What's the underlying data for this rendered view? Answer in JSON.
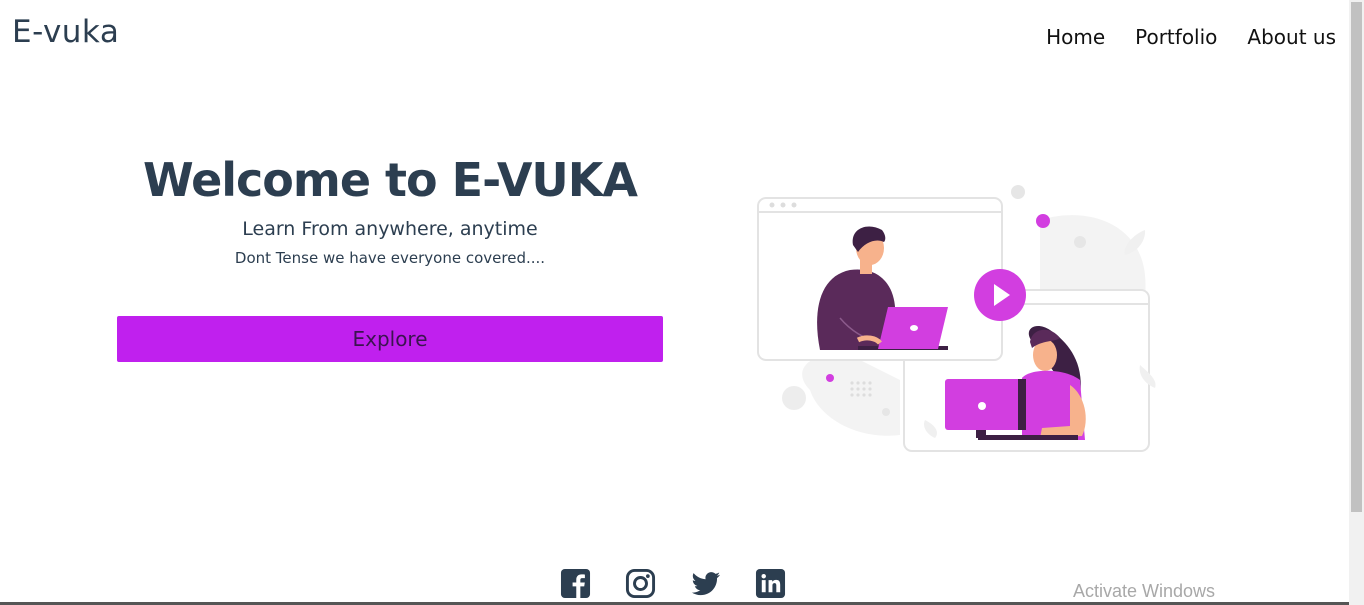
{
  "header": {
    "logo": "E-vuka",
    "nav": [
      "Home",
      "Portfolio",
      "About us"
    ]
  },
  "hero": {
    "title": "Welcome to E-VUKA",
    "subtitle": "Learn From anywhere, anytime",
    "tagline": "Dont Tense we have everyone covered....",
    "button_label": "Explore"
  },
  "illustration": {
    "name": "online-learning-illustration",
    "accent_color": "#d23ee0"
  },
  "social": {
    "icons": [
      "facebook-icon",
      "instagram-icon",
      "twitter-icon",
      "linkedin-icon"
    ]
  },
  "os_watermark": "Activate Windows",
  "colors": {
    "heading": "#2c3e50",
    "button": "#c020ee"
  }
}
